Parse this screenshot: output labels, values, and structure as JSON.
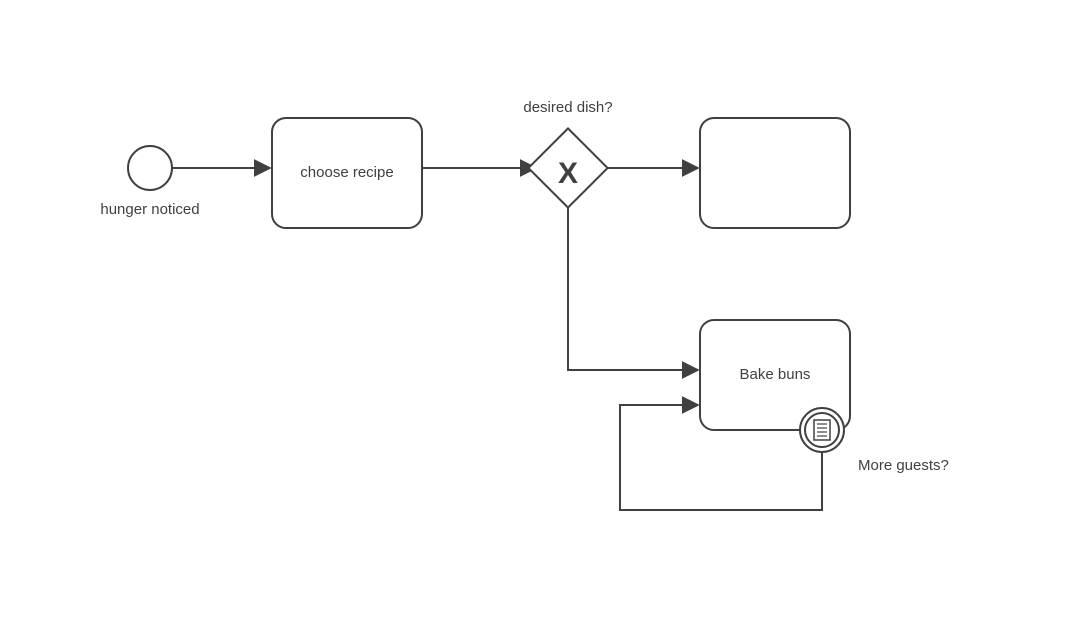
{
  "diagram": {
    "startEvent": {
      "label": "hunger noticed"
    },
    "task1": {
      "label": "choose recipe"
    },
    "gateway": {
      "label": "desired dish?",
      "marker": "X"
    },
    "task2": {
      "label": ""
    },
    "task3": {
      "label": "Bake buns"
    },
    "boundaryEvent": {
      "label": "More guests?",
      "type": "conditional"
    }
  }
}
